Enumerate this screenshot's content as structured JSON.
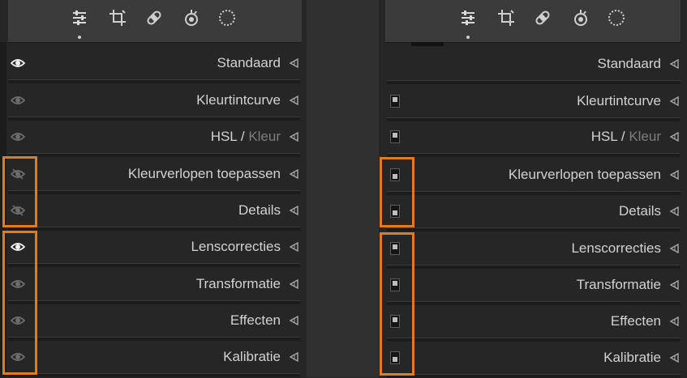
{
  "toolstrip": {
    "tools": [
      "sliders-icon",
      "crop-icon",
      "heal-bandage-icon",
      "red-eye-icon",
      "mask-circle-icon"
    ],
    "active_tool": "sliders-icon"
  },
  "left_panel": {
    "rows": [
      {
        "label": "Standaard",
        "eye": "visible-bright"
      },
      {
        "label": "Kleurtintcurve",
        "eye": "visible-dim"
      },
      {
        "label_main": "HSL",
        "label_sep": " / ",
        "label_dim": "Kleur",
        "eye": "visible-dim"
      },
      {
        "label": "Kleurverlopen toepassen",
        "eye": "hidden"
      },
      {
        "label": "Details",
        "eye": "hidden"
      },
      {
        "label": "Lenscorrecties",
        "eye": "visible-bright"
      },
      {
        "label": "Transformatie",
        "eye": "visible-dim"
      },
      {
        "label": "Effecten",
        "eye": "visible-dim"
      },
      {
        "label": "Kalibratie",
        "eye": "visible-dim"
      }
    ]
  },
  "right_panel": {
    "rows": [
      {
        "label": "Standaard",
        "switch": "none"
      },
      {
        "label": "Kleurtintcurve",
        "switch": "on"
      },
      {
        "label_main": "HSL",
        "label_sep": " / ",
        "label_dim": "Kleur",
        "switch": "on"
      },
      {
        "label": "Kleurverlopen toepassen",
        "switch": "off"
      },
      {
        "label": "Details",
        "switch": "off"
      },
      {
        "label": "Lenscorrecties",
        "switch": "on"
      },
      {
        "label": "Transformatie",
        "switch": "on"
      },
      {
        "label": "Effecten",
        "switch": "on"
      },
      {
        "label": "Kalibratie",
        "switch": "off"
      }
    ]
  },
  "colors": {
    "highlight": "#e07b20",
    "panel_bg": "#262626",
    "text": "#d2d2d2"
  }
}
